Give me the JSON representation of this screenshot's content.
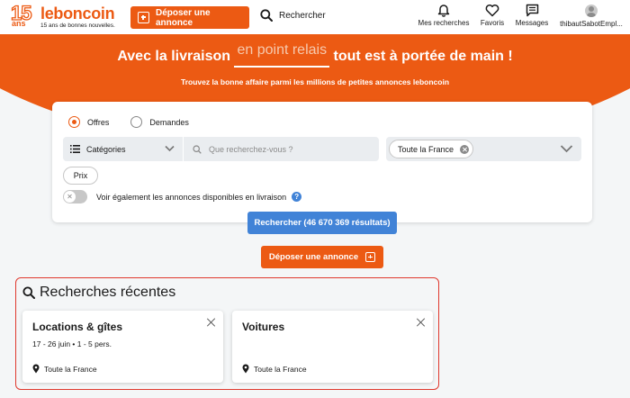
{
  "header": {
    "logo": {
      "anniversary": "15",
      "ans": "ans",
      "brand": "leboncoin",
      "tagline": "15 ans de bonnes nouvelles."
    },
    "post_ad_label": "Déposer une annonce",
    "search_label": "Rechercher",
    "nav": [
      {
        "label": "Mes recherches",
        "icon": "bell-icon"
      },
      {
        "label": "Favoris",
        "icon": "heart-icon"
      },
      {
        "label": "Messages",
        "icon": "message-icon"
      },
      {
        "label": "thibautSabotEmpl...",
        "icon": "avatar-icon"
      }
    ]
  },
  "banner": {
    "title_before": "Avec la livraison",
    "title_highlight": "en point relais",
    "title_after": "tout est à portée de main !",
    "subtitle": "Trouvez la bonne affaire parmi les millions de petites annonces leboncoin"
  },
  "search": {
    "radio_offers": "Offres",
    "radio_requests": "Demandes",
    "selected": "Offres",
    "category_label": "Catégories",
    "query_placeholder": "Que recherchez-vous ?",
    "query_value": "",
    "location_chip": "Toute la France",
    "price_filter": "Prix",
    "delivery_toggle_label": "Voir également les annonces disponibles en livraison",
    "delivery_toggle_on": false,
    "submit_label": "Rechercher (46 670 369 résultats)"
  },
  "post_ad_button": "Déposer une annonce",
  "recent_searches": {
    "title": "Recherches récentes",
    "items": [
      {
        "title": "Locations & gîtes",
        "detail": "17 - 26 juin • 1 - 5 pers.",
        "location": "Toute la France"
      },
      {
        "title": "Voitures",
        "detail": "",
        "location": "Toute la France"
      }
    ]
  },
  "colors": {
    "brand_orange": "#ec5a13",
    "action_blue": "#4183d7",
    "highlight_border": "#e0392e"
  }
}
